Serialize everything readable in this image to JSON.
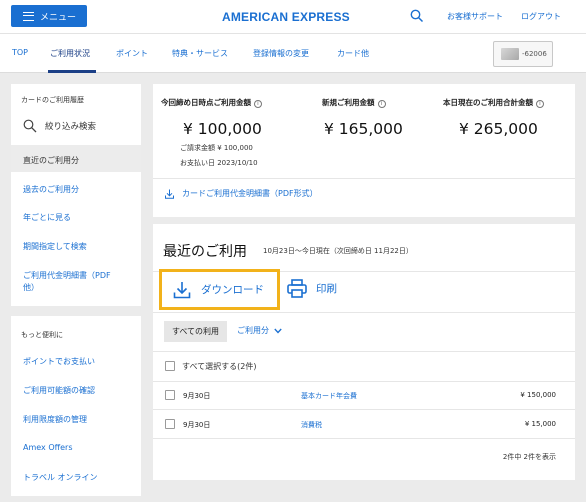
{
  "header": {
    "menu_label": "メニュー",
    "brand": "AMERICAN EXPRESS",
    "support_label": "お客様サポート",
    "logout_label": "ログアウト"
  },
  "nav": {
    "items": [
      {
        "label": "TOP"
      },
      {
        "label": "ご利用状況"
      },
      {
        "label": "ポイント"
      },
      {
        "label": "特典・サービス"
      },
      {
        "label": "登録情報の変更"
      },
      {
        "label": "カード他"
      }
    ],
    "active_index": 1,
    "card_number": "-62006"
  },
  "sidebar": {
    "section1_title": "カードのご利用履歴",
    "filter_label": "絞り込み検索",
    "links": [
      {
        "label": "直近のご利用分"
      },
      {
        "label": "過去のご利用分"
      },
      {
        "label": "年ごとに見る"
      },
      {
        "label": "期間指定して検索"
      },
      {
        "label": "ご利用代金明細書（PDF"
      },
      {
        "label": "他）"
      }
    ],
    "section2_title": "もっと便利に",
    "links2": [
      {
        "label": "ポイントでお支払い"
      },
      {
        "label": "ご利用可能額の確認"
      },
      {
        "label": "利用限度額の管理"
      },
      {
        "label": "Amex Offers"
      },
      {
        "label": "トラベル オンライン"
      }
    ]
  },
  "summary": {
    "col1": {
      "title": "今回締め日時点ご利用金額",
      "amount": "¥ 100,000",
      "billing": "ご請求金額 ¥ 100,000",
      "payment_date": "お支払い日 2023/10/10"
    },
    "col2": {
      "title": "新規ご利用金額",
      "amount": "¥ 165,000"
    },
    "col3": {
      "title": "本日現在のご利用合計金額",
      "amount": "¥ 265,000"
    },
    "pdf_link": "カードご利用代金明細書（PDF形式）"
  },
  "recent": {
    "title": "最近のご利用",
    "period": "10月23日～今日現在（次回締め日 11月22日）",
    "download_label": "ダウンロード",
    "print_label": "印刷",
    "tab_all": "すべての利用",
    "tab_usage": "ご利用分",
    "select_all": "すべて選択する(2件)",
    "rows": [
      {
        "date": "9月30日",
        "desc": "基本カード年会費",
        "amount": "¥ 150,000"
      },
      {
        "date": "9月30日",
        "desc": "消費税",
        "amount": "¥ 15,000"
      }
    ],
    "pager": "2件中 2件を表示"
  },
  "colors": {
    "brand_blue": "#1a6fd1",
    "highlight": "#f2b21a",
    "navy": "#1b3f86"
  }
}
